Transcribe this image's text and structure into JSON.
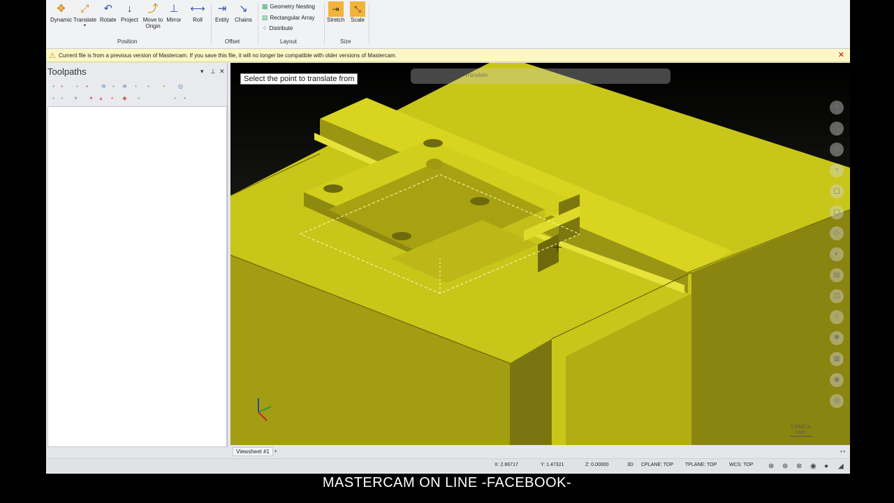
{
  "ribbon": {
    "position_buttons": [
      "Dynamic",
      "Translate",
      "Rotate",
      "Project",
      "Move to Origin",
      "Mirror",
      "Roll"
    ],
    "position_label": "Position",
    "offset_buttons": [
      "Entity",
      "Chains"
    ],
    "offset_label": "Offset",
    "layout_items": [
      "Geometry Nesting",
      "Rectangular Array",
      "Distribute"
    ],
    "layout_label": "Layout",
    "size_buttons": [
      "Stretch",
      "Scale"
    ],
    "size_label": "Size"
  },
  "warning": {
    "text": "Current file is from a previous version of Mastercam. If you save this file, it will no longer be compatible with older versions of Mastercam."
  },
  "toolpaths": {
    "title": "Toolpaths"
  },
  "viewport": {
    "prompt": "Select the point to translate from",
    "ghost_label": "Gnomon / Translate",
    "scale_value": "0.5332 in",
    "scale_unit": "Inch",
    "model_color": "#c9c61a"
  },
  "tabs": {
    "active": "Viewsheet #1",
    "add": "+"
  },
  "status": {
    "x": "X:  2.66717",
    "y": "Y:  1.47321",
    "z": "Z:  0.00000",
    "mode": "3D",
    "cplane": "CPLANE: TOP",
    "tplane": "TPLANE: TOP",
    "wcs": "WCS: TOP"
  },
  "caption": "MASTERCAM ON LINE -FACEBOOK-"
}
